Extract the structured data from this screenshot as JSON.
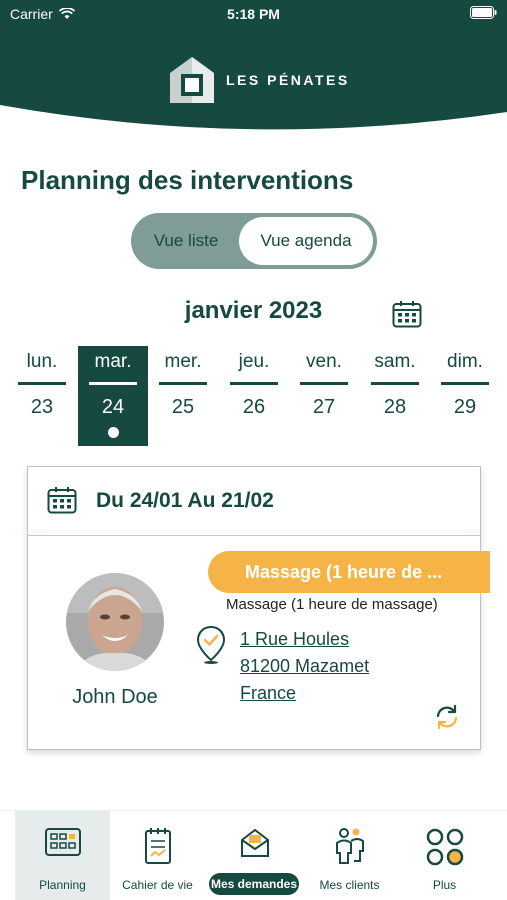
{
  "status_bar": {
    "carrier": "Carrier",
    "time": "5:18 PM"
  },
  "brand": {
    "name": "LES PÉNATES"
  },
  "page": {
    "title": "Planning des interventions"
  },
  "view_toggle": {
    "list_label": "Vue liste",
    "agenda_label": "Vue agenda",
    "selected": "Vue agenda"
  },
  "calendar": {
    "month_label": "janvier 2023",
    "days": [
      {
        "name": "lun.",
        "num": "23"
      },
      {
        "name": "mar.",
        "num": "24"
      },
      {
        "name": "mer.",
        "num": "25"
      },
      {
        "name": "jeu.",
        "num": "26"
      },
      {
        "name": "ven.",
        "num": "27"
      },
      {
        "name": "sam.",
        "num": "28"
      },
      {
        "name": "dim.",
        "num": "29"
      }
    ],
    "selected_day": "24"
  },
  "intervention": {
    "period": "Du 24/01 Au 21/02",
    "service_badge": "Massage (1 heure de ...",
    "service_full": "Massage (1 heure de massage)",
    "client_name": "John Doe",
    "address": {
      "line1": "1 Rue Houles",
      "line2": "81200 Mazamet",
      "line3": "France"
    }
  },
  "tabbar": {
    "items": [
      {
        "label": "Planning",
        "icon": "calendar-grid-icon",
        "active": true
      },
      {
        "label": "Cahier de vie",
        "icon": "notebook-icon",
        "active": false
      },
      {
        "label": "Mes demandes",
        "icon": "envelope-icon",
        "active": false
      },
      {
        "label": "Mes clients",
        "icon": "people-icon",
        "active": false
      },
      {
        "label": "Plus",
        "icon": "more-circles-icon",
        "active": false
      }
    ]
  },
  "colors": {
    "primary": "#16493f",
    "accent": "#f5b445",
    "toggle_track": "#7f9d96",
    "active_tab_bg": "#e6eceb"
  }
}
